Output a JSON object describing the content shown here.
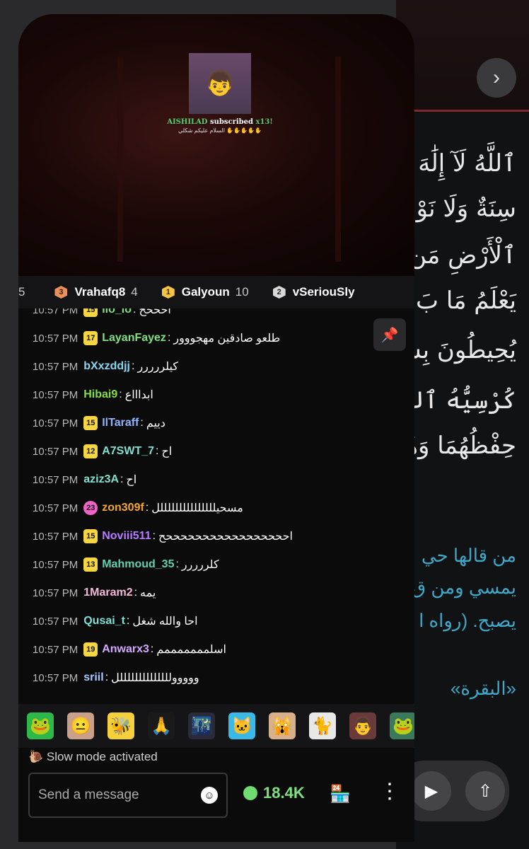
{
  "background_app": {
    "next_icon": "chevron-right-icon",
    "verse_lines": [
      "ٱللَّهُ لَآ إِلَٰهَ إِ",
      "سِنَةٌ وَلَا نَوْ",
      "ٱلْأَرْضِ مَن ذَ",
      "يَعْلَمُ مَا بَ",
      "يُحِيطُونَ بِشَ",
      "كُرْسِيُّهُ ٱلسَّ",
      "حِفْظُهُمَا وَهُوَ"
    ],
    "hadith_lines": [
      "من قالها حي",
      "يمسي ومن ق",
      "يصبح. (رواه ا"
    ],
    "surah_label": "«البقرة»",
    "play_icon": "play-icon",
    "share_icon": "share-icon"
  },
  "stream": {
    "sub_alert": {
      "name": "AISHILAD",
      "text": "subscribed",
      "count": "x13!",
      "message": "السلام عليكم شكلي ✋✋✋✋✋"
    }
  },
  "leaderboard": [
    {
      "rank": "",
      "name": "",
      "score": "5"
    },
    {
      "rank": "3",
      "name": "Vrahafq8",
      "score": "4",
      "color": "#e8915a"
    },
    {
      "rank": "1",
      "name": "Galyoun",
      "score": "10",
      "color": "#f5c542"
    },
    {
      "rank": "2",
      "name": "vSeriouSly",
      "score": "",
      "color": "#d8d8d8"
    }
  ],
  "chat": {
    "partial": {
      "time": "10:57 PM",
      "badge": "15",
      "user": "llo_lo",
      "text": "احححح"
    },
    "messages": [
      {
        "time": "10:57 PM",
        "badge": "17",
        "user": "LayanFayez",
        "color": "#7fe07f",
        "text": "طلعو صادقين مهجووور"
      },
      {
        "time": "10:57 PM",
        "badge": "",
        "user": "bXxzddjj",
        "color": "#8ad4ef",
        "text": "كيلررررر"
      },
      {
        "time": "10:57 PM",
        "badge": "",
        "user": "Hibai9",
        "color": "#7fe042",
        "text": "ابداااع"
      },
      {
        "time": "10:57 PM",
        "badge": "15",
        "user": "IlTaraff",
        "color": "#8fb4ff",
        "text": "دييم"
      },
      {
        "time": "10:57 PM",
        "badge": "12",
        "user": "A7SWT_7",
        "color": "#7fe0d0",
        "text": "اح"
      },
      {
        "time": "10:57 PM",
        "badge": "",
        "user": "aziz3A",
        "color": "#7fe0d0",
        "text": "اح"
      },
      {
        "time": "10:57 PM",
        "badge": "23",
        "badge_style": "pink",
        "user": "zon309f",
        "color": "#f5a623",
        "text": "مسحيلللللللللللللللل"
      },
      {
        "time": "10:57 PM",
        "badge": "15",
        "user": "Noviii511",
        "color": "#b77dff",
        "text": "احححححححححححححححححح"
      },
      {
        "time": "10:57 PM",
        "badge": "13",
        "user": "Mahmoud_35",
        "color": "#5fd0b0",
        "text": "كلررررر"
      },
      {
        "time": "10:57 PM",
        "badge": "",
        "user": "1Maram2",
        "color": "#f2b8d8",
        "text": "يمه"
      },
      {
        "time": "10:57 PM",
        "badge": "",
        "user": "Qusai_t",
        "color": "#7ce0d6",
        "text": "احا والله شغل"
      },
      {
        "time": "10:57 PM",
        "badge": "19",
        "user": "Anwarx3",
        "color": "#d2a8ff",
        "text": "اسلمممممممم"
      },
      {
        "time": "10:57 PM",
        "badge": "",
        "user": "sriil",
        "color": "#a8c8ff",
        "text": "وووووللللللللللللللل"
      }
    ],
    "pin_icon": "pin-icon"
  },
  "emotes": [
    "frog-emote-icon",
    "face-emote-icon",
    "bee-emote-icon",
    "hands-emote-icon",
    "night-emote-icon",
    "cat-emote-icon",
    "cat-scream-emote-icon",
    "cat-stare-emote-icon",
    "person-emote-icon",
    "pepe-emote-icon"
  ],
  "footer": {
    "slow_mode": "Slow mode activated",
    "placeholder": "Send a message",
    "points": "18.4K",
    "store_icon": "store-icon",
    "more_icon": "more-vertical-icon",
    "emoji_icon": "smiley-icon"
  }
}
